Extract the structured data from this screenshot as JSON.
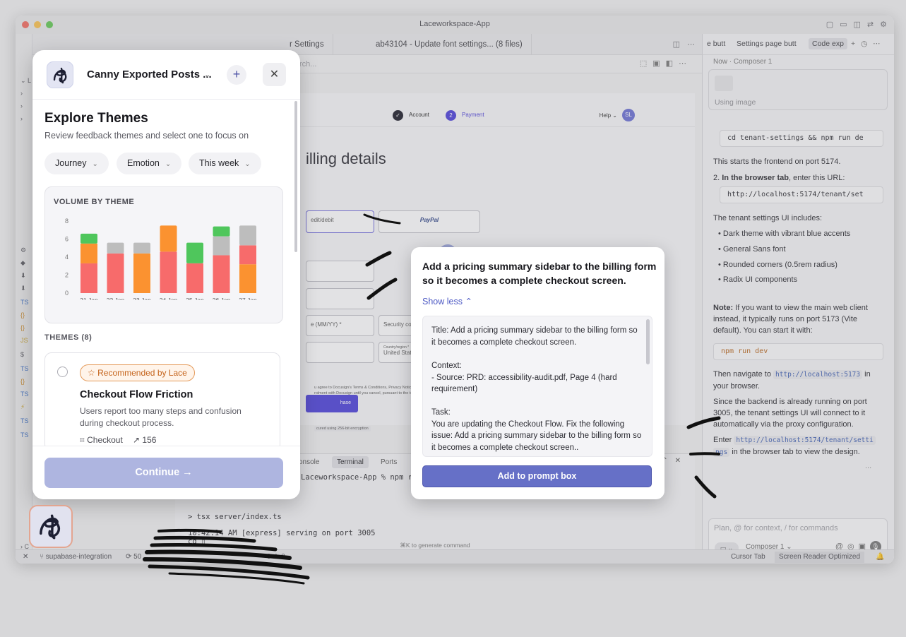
{
  "window": {
    "title": "Laceworkspace-App",
    "titlebar_icons": [
      "sidebar-icon",
      "panel-icon",
      "layout-icon",
      "swap-icon",
      "gear-icon"
    ]
  },
  "editor": {
    "tabs": [
      "r Settings",
      "ab43104 - Update font settings... (8 files)"
    ],
    "search_placeholder": "rch..."
  },
  "preview": {
    "steps": [
      {
        "num": "✓",
        "label": "Account"
      },
      {
        "num": "2",
        "label": "Payment"
      }
    ],
    "help": "Help ⌄",
    "avatar": "SL",
    "heading": "illing details",
    "option_card": "edit/debit",
    "option_paypal": "PayPal",
    "fields": {
      "expiry": "e (MM/YY) *",
      "security": "Security code *",
      "country_label": "Country/region *",
      "country": "United State"
    },
    "legal": "u agree to Docusign's Terms & Conditions, Privacy Notice",
    "legal2": "rolment with Docusign until you cancel, pursuant to the terms",
    "purchase": "hase",
    "secure": "cured using 256-bit encryption"
  },
  "terminal": {
    "tabs": [
      "onsole",
      "Terminal",
      "Ports"
    ],
    "lines": [
      "Laceworkspace-App % npm ru",
      "> tsx server/index.ts",
      "10:42:14 AM [express] serving on port 3005",
      "cd ▯"
    ],
    "generate_hint": "⌘K to generate command"
  },
  "statusbar": {
    "branch": "supabase-integration",
    "sync": "50",
    "problems": "0 ⚠ 0",
    "cursor_tab": "Cursor Tab",
    "screen_reader": "Screen Reader Optimized"
  },
  "chat": {
    "tabs": [
      "e butt",
      "Settings page butt",
      "Code exp"
    ],
    "subheader": "Now · Composer 1",
    "image_label": "Using image",
    "cmd1": "cd tenant-settings && npm run de",
    "p_start": "This starts the frontend on port 5174.",
    "step2_prefix": "2.",
    "step2_bold": "In the browser tab",
    "step2_rest": ", enter this URL:",
    "url_box": "http://localhost:5174/tenant/set",
    "includes": "The tenant settings UI includes:",
    "bullets": [
      "Dark theme with vibrant blue accents",
      "General Sans font",
      "Rounded corners (0.5rem radius)",
      "Radix UI components"
    ],
    "note_bold": "Note:",
    "note_rest": " If you want to view the main web client instead, it typically runs on port 5173 (Vite default). You can start it with:",
    "cmd2": "npm run dev",
    "nav_prefix": "Then navigate to ",
    "nav_url": "http://localhost:5173",
    "nav_suffix": " in your browser.",
    "since": "Since the backend is already running on port 3005, the tenant settings UI will connect to it automatically via the proxy configuration.",
    "enter_prefix": "Enter ",
    "enter_url_a": "http://localhost:5174/tenant/setti",
    "enter_url_b": "ngs",
    "enter_suffix": " in the browser tab to view the design.",
    "ellipsis": "...",
    "input_placeholder": "Plan, @ for context, / for commands",
    "composer_label": "Composer 1"
  },
  "modal": {
    "workspace_name": "Canny Exported Posts ...",
    "title": "Explore Themes",
    "subtitle": "Review feedback themes and select one to focus on",
    "filters": [
      "Journey",
      "Emotion",
      "This week"
    ],
    "volume_title": "VOLUME BY THEME",
    "themes_header": "THEMES (8)",
    "theme_card": {
      "badge": "Recommended by Lace",
      "title": "Checkout Flow Friction",
      "description": "Users report too many steps and confusion during checkout process.",
      "tag": "Checkout",
      "count": "156"
    },
    "continue_label": "Continue"
  },
  "chart_data": {
    "type": "bar",
    "title": "VOLUME BY THEME",
    "categories": [
      "21 Jan",
      "22 Jan",
      "23 Jan",
      "24 Jan",
      "25 Jan",
      "26 Jan",
      "27 Jan"
    ],
    "yticks": [
      0,
      2,
      4,
      6,
      8
    ],
    "ylim": [
      0,
      8
    ],
    "stacked": true,
    "series": [
      {
        "color": "#f76b6b",
        "values": [
          3.3,
          4.4,
          0,
          4.6,
          3.3,
          4.2,
          0.0
        ]
      },
      {
        "color": "#fb9230",
        "values": [
          2.2,
          0,
          4.4,
          2.9,
          0,
          0,
          3.2
        ]
      },
      {
        "color": "#f76b6b",
        "values": [
          0,
          0,
          0,
          0,
          0,
          0,
          2.1
        ]
      },
      {
        "color": "#bdbdbd",
        "values": [
          0,
          1.2,
          1.2,
          0,
          0,
          2.1,
          2.2
        ]
      },
      {
        "color": "#4fc65c",
        "values": [
          1.1,
          0,
          0,
          0,
          2.3,
          1.1,
          0
        ]
      }
    ]
  },
  "popup": {
    "title": "Add a pricing summary sidebar to the billing form so it becomes a complete checkout screen.",
    "show_less": "Show less",
    "paragraphs": [
      "Title: Add a pricing summary sidebar to the billing form so it becomes a complete checkout screen.",
      "Context:\n- Source: PRD: accessibility-audit.pdf, Page 4 (hard requirement)",
      "Task:\nYou are updating the Checkout Flow. Fix the following issue: Add a pricing summary sidebar to the billing form so it becomes a complete checkout screen.."
    ],
    "add_button": "Add to prompt box"
  },
  "colors": {
    "accent": "#6670c7",
    "recommend": "#c5641c",
    "continue_disabled": "#aeb5e0"
  }
}
